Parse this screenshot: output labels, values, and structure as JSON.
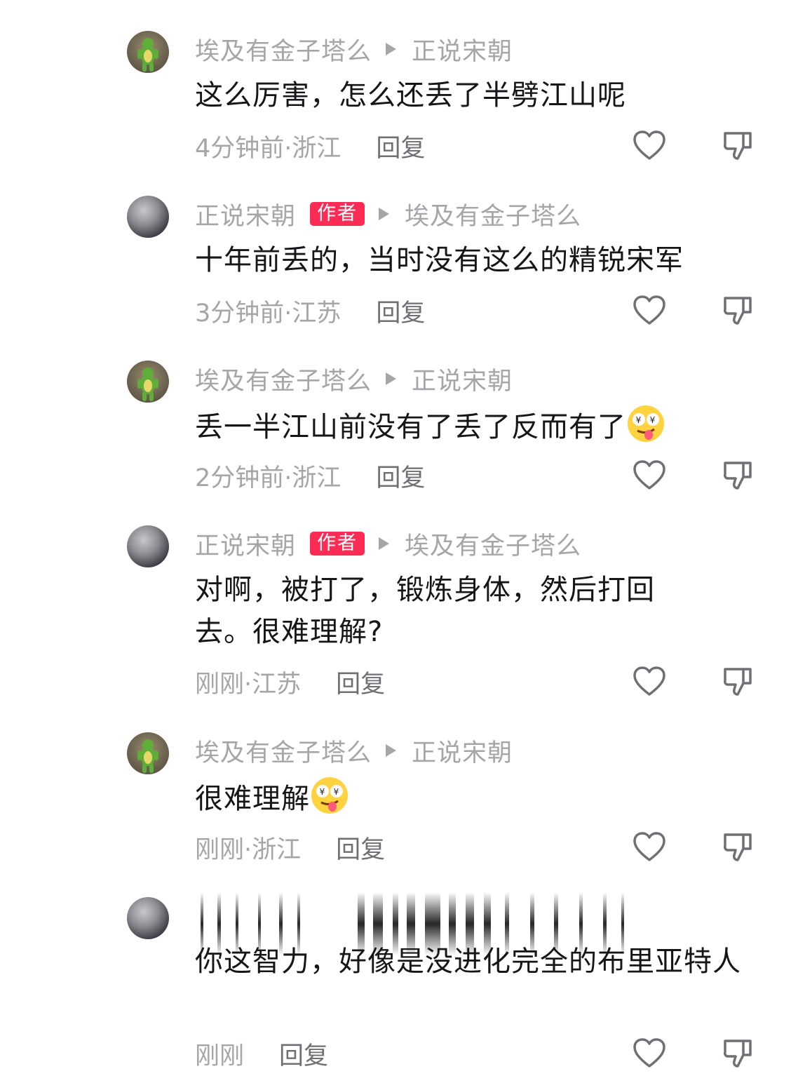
{
  "comments": [
    {
      "avatar": "frog-avatar",
      "user": "埃及有金子塔么",
      "is_author": false,
      "reply_to": "正说宋朝",
      "text": "这么厉害，怎么还丢了半劈江山呢",
      "time_loc": "4分钟前·浙江",
      "reply_label": "回复"
    },
    {
      "avatar": "storm-avatar",
      "user": "正说宋朝",
      "is_author": true,
      "badge": "作者",
      "reply_to": "埃及有金子塔么",
      "text": "十年前丢的，当时没有这么的精锐宋军",
      "time_loc": "3分钟前·江苏",
      "reply_label": "回复"
    },
    {
      "avatar": "frog-avatar",
      "user": "埃及有金子塔么",
      "is_author": false,
      "reply_to": "正说宋朝",
      "text": "丢一半江山前没有了丢了反而有了",
      "emoji": "drooling-money-eyes-emoji",
      "time_loc": "2分钟前·浙江",
      "reply_label": "回复"
    },
    {
      "avatar": "storm-avatar",
      "user": "正说宋朝",
      "is_author": true,
      "badge": "作者",
      "reply_to": "埃及有金子塔么",
      "text": "对啊，被打了，锻炼身体，然后打回去。很难理解?",
      "time_loc": "刚刚·江苏",
      "reply_label": "回复"
    },
    {
      "avatar": "frog-avatar",
      "user": "埃及有金子塔么",
      "is_author": false,
      "reply_to": "正说宋朝",
      "text": "很难理解",
      "emoji": "drooling-money-eyes-emoji",
      "time_loc": "刚刚·浙江",
      "reply_label": "回复"
    },
    {
      "avatar": "storm-avatar",
      "header_redacted": true,
      "text": "你这智力，好像是没进化完全的布里亚特人",
      "time_loc": "刚刚",
      "reply_label": "回复"
    }
  ],
  "icons": {
    "like": "heart-outline-icon",
    "dislike": "thumbs-down-outline-icon"
  },
  "colors": {
    "author_badge": "#fe2c55",
    "muted_text": "#a6a6aa",
    "body_text": "#16161a",
    "reply_text": "#6f6f75"
  }
}
